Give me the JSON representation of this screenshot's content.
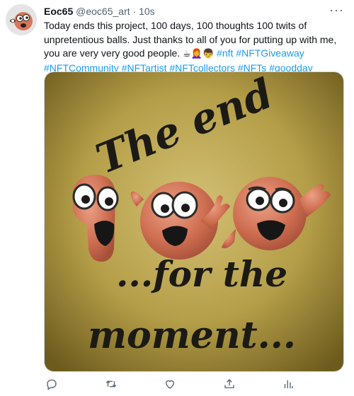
{
  "tweet": {
    "author_name": "Eoc65",
    "author_handle": "@eoc65_art",
    "separator": "·",
    "time": "10s",
    "more_label": "···",
    "text_plain": "Today ends this project, 100 days, 100 thoughts 100 twits of unpretentious balls. Just thanks to all of you for putting up with me, you are very very good people. ",
    "emojis": "☕👩‍🦰👦",
    "hashtags": [
      "#nft",
      "#NFTGiveaway",
      "#NFTCommunity",
      "#NFTartist",
      "#NFTcollectors",
      "#NFTs",
      "#goodday"
    ],
    "image": {
      "text_top": "The end",
      "text_bottom_1": "...for the",
      "text_bottom_2": "moment..."
    },
    "action_icons": [
      "reply-icon",
      "retweet-icon",
      "like-icon",
      "share-icon",
      "analytics-icon"
    ]
  },
  "colors": {
    "link": "#1d9bf0",
    "secondary": "#536471",
    "ball": "#d6765a",
    "background_light": "#ccb868",
    "background_dark": "#6f5d20"
  }
}
